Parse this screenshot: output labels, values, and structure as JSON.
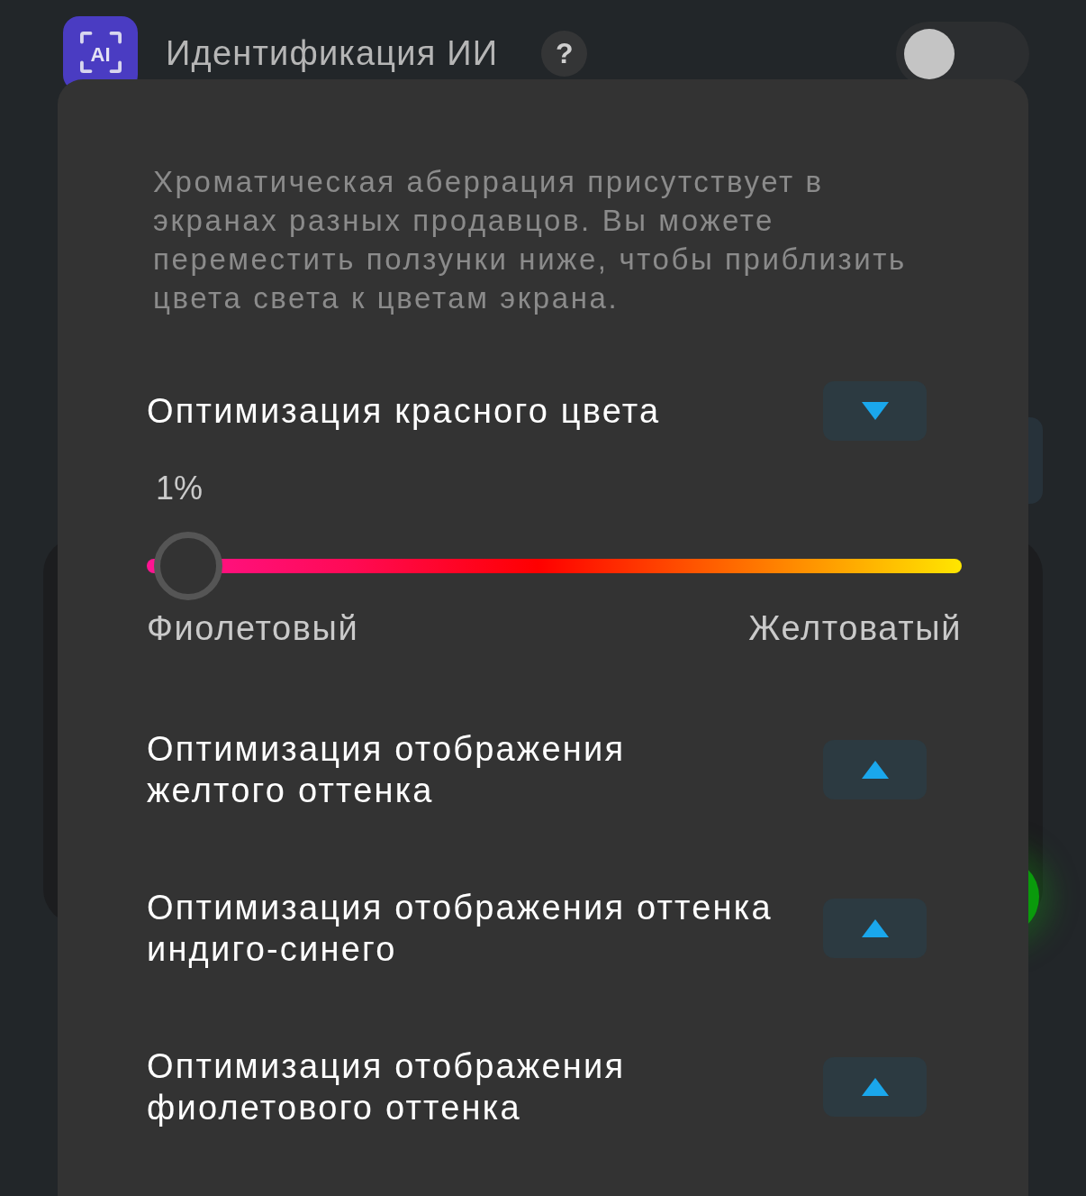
{
  "header": {
    "logo_text": "AI",
    "title": "Идентификация ИИ",
    "help": "?",
    "toggle": {
      "on": false
    }
  },
  "panel": {
    "description": "Хроматическая аберрация присутствует в\nэкранах разных продавцов. Вы можете\nпереместить ползунки ниже, чтобы приблизить\nцвета света к цветам экрана.",
    "sections": [
      {
        "title": "Оптимизация красного цвета",
        "expanded": true,
        "slider": {
          "reading": "1%",
          "level": 0.01,
          "min_label": "Фиолетовый",
          "max_label": "Желтоватый"
        }
      },
      {
        "title": "Оптимизация отображения\nжелтого оттенка",
        "expanded": false
      },
      {
        "title": "Оптимизация отображения оттенка\nиндиго-синего",
        "expanded": false
      },
      {
        "title": "Оптимизация отображения\nфиолетового оттенка",
        "expanded": false
      }
    ]
  }
}
